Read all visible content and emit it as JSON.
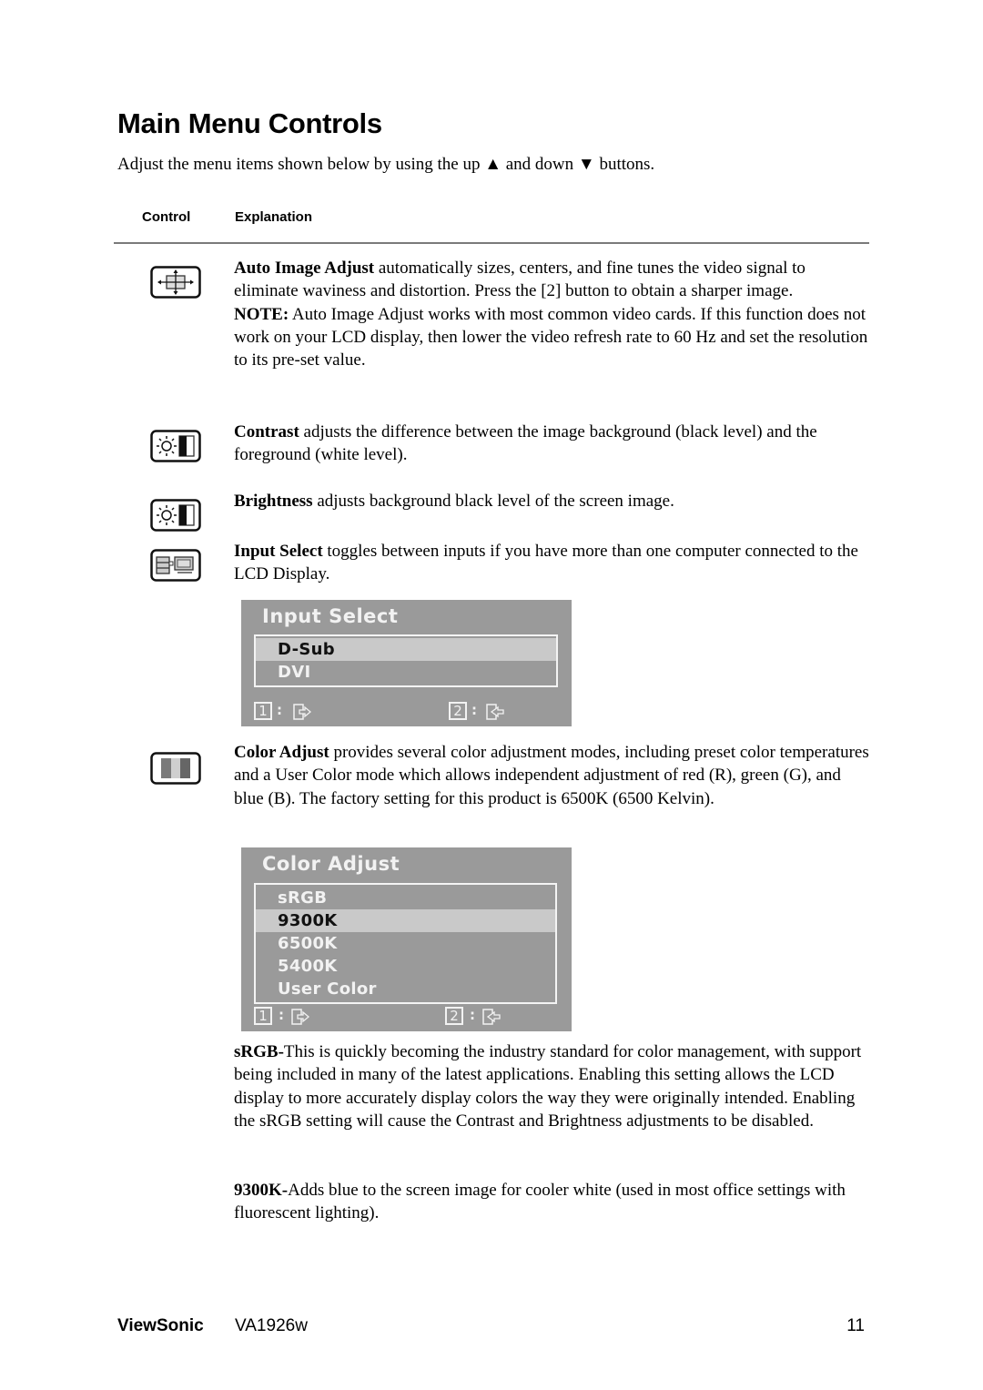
{
  "page": {
    "title": "Main Menu Controls",
    "intro": "Adjust the menu items shown below by using the up ▲ and down ▼ buttons.",
    "table_headers": {
      "control": "Control",
      "explanation": "Explanation"
    }
  },
  "controls": {
    "auto_image_adjust": {
      "icon": "auto-image-adjust-icon",
      "name": "Auto Image Adjust",
      "text": " automatically sizes, centers, and fine tunes the video signal to eliminate waviness and distortion. Press the [2] button to obtain a sharper image.",
      "note_label": "NOTE:",
      "note_text": " Auto Image Adjust works with most common video cards. If this function does not work on your LCD display, then lower the video refresh rate to 60 Hz and set the resolution to its pre-set value."
    },
    "contrast": {
      "icon": "contrast-icon",
      "name": "Contrast",
      "text": " adjusts the difference between the image background  (black level) and the foreground (white level)."
    },
    "brightness": {
      "icon": "brightness-icon",
      "name": "Brightness",
      "text": " adjusts background black level of the screen image."
    },
    "input_select": {
      "icon": "input-select-icon",
      "name": "Input Select",
      "text": " toggles between inputs if you have more than one computer connected to the LCD Display."
    },
    "color_adjust": {
      "icon": "color-adjust-icon",
      "name": "Color Adjust",
      "text": " provides several color adjustment modes, including preset color temperatures and a User Color mode which allows independent adjustment of red (R), green (G), and blue (B). The factory setting for this product is 6500K (6500 Kelvin)."
    },
    "srgb": {
      "name": "sRGB-",
      "text": "This is quickly becoming the industry standard for color management, with support being included in many of the latest applications. Enabling this setting allows the LCD display to more accurately display colors the way they were originally intended. Enabling the sRGB setting will cause the Contrast and Brightness adjustments to be disabled."
    },
    "k9300": {
      "name": "9300K-",
      "text": "Adds blue to the screen image for cooler white (used in most office settings with fluorescent lighting)."
    }
  },
  "osd_input_select": {
    "title": "Input Select",
    "items": [
      {
        "label": "D-Sub",
        "selected": true
      },
      {
        "label": "DVI",
        "selected": false
      }
    ],
    "footer": {
      "key1": "1",
      "key1_icon": "exit-icon",
      "key2": "2",
      "key2_icon": "enter-icon",
      "separator": ":"
    }
  },
  "osd_color_adjust": {
    "title": "Color Adjust",
    "items": [
      {
        "label": "sRGB",
        "selected": false
      },
      {
        "label": "9300K",
        "selected": true
      },
      {
        "label": "6500K",
        "selected": false
      },
      {
        "label": "5400K",
        "selected": false
      },
      {
        "label": "User Color",
        "selected": false
      }
    ],
    "footer": {
      "key1": "1",
      "key1_icon": "exit-icon",
      "key2": "2",
      "key2_icon": "enter-icon",
      "separator": ":"
    }
  },
  "footer": {
    "brand": "ViewSonic",
    "model": "VA1926w",
    "page_number": "11"
  },
  "colors": {
    "osd_background": "#9a9a9a",
    "osd_selected": "#c9c9c9",
    "osd_text": "#f2f2f2",
    "rule": "#7a7a7a"
  }
}
